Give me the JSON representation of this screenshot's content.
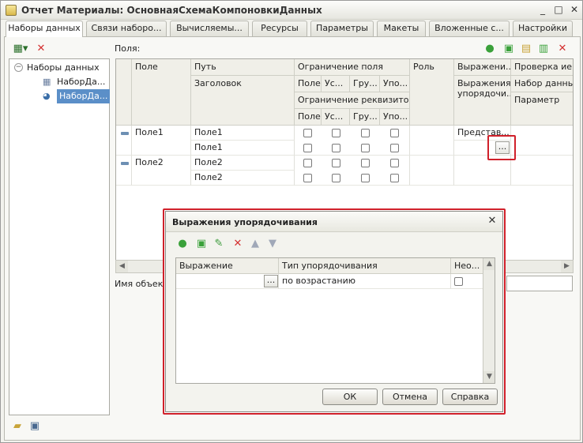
{
  "window": {
    "title": "Отчет Материалы: ОсновнаяСхемаКомпоновкиДанных",
    "minimize": "_",
    "maximize": "□",
    "close": "✕"
  },
  "tabs": [
    {
      "label": "Наборы данных",
      "active": true
    },
    {
      "label": "Связи наборо..."
    },
    {
      "label": "Вычисляемы..."
    },
    {
      "label": "Ресурсы"
    },
    {
      "label": "Параметры"
    },
    {
      "label": "Макеты"
    },
    {
      "label": "Вложенные с..."
    },
    {
      "label": "Настройки"
    }
  ],
  "tree": {
    "root": "Наборы данных",
    "items": [
      {
        "label": "НаборДа..."
      },
      {
        "label": "НаборДа...",
        "selected": true
      }
    ]
  },
  "fields_label": "Поля:",
  "grid": {
    "headers": {
      "field": "Поле",
      "path": "Путь",
      "title": "Заголовок",
      "field_restriction": "Ограничение поля",
      "attr_restriction": "Ограничение реквизитов",
      "sub_field": "Поле",
      "sub_cond": "Ус...",
      "sub_group": "Гру...",
      "sub_order": "Упо...",
      "role": "Роль",
      "expressions": "Выражени...",
      "order_expressions": "Выражения упорядочи...",
      "hierarchy_check": "Проверка иера",
      "dataset": "Набор данных",
      "parameter": "Параметр"
    },
    "rows": [
      {
        "field": "Поле1",
        "path": "Поле1",
        "title": "Поле1",
        "expression": "Представ...",
        "ellipsis": "..."
      },
      {
        "field": "Поле2",
        "path": "Поле2",
        "title": "Поле2"
      }
    ]
  },
  "object_name_label": "Имя объекта",
  "dialog": {
    "title": "Выражения упорядочивания",
    "close": "✕",
    "columns": {
      "expression": "Выражение",
      "order_type": "Тип упорядочивания",
      "non_auto": "Нео..."
    },
    "row": {
      "expression": "",
      "ellipsis": "...",
      "order_type": "по возрастанию"
    },
    "buttons": {
      "ok": "ОК",
      "cancel": "Отмена",
      "help": "Справка"
    }
  },
  "colors": {
    "selection": "#5b8fc8",
    "highlight_box": "#d0202a",
    "add_icon": "#3aa13a",
    "delete_icon": "#d43030"
  }
}
